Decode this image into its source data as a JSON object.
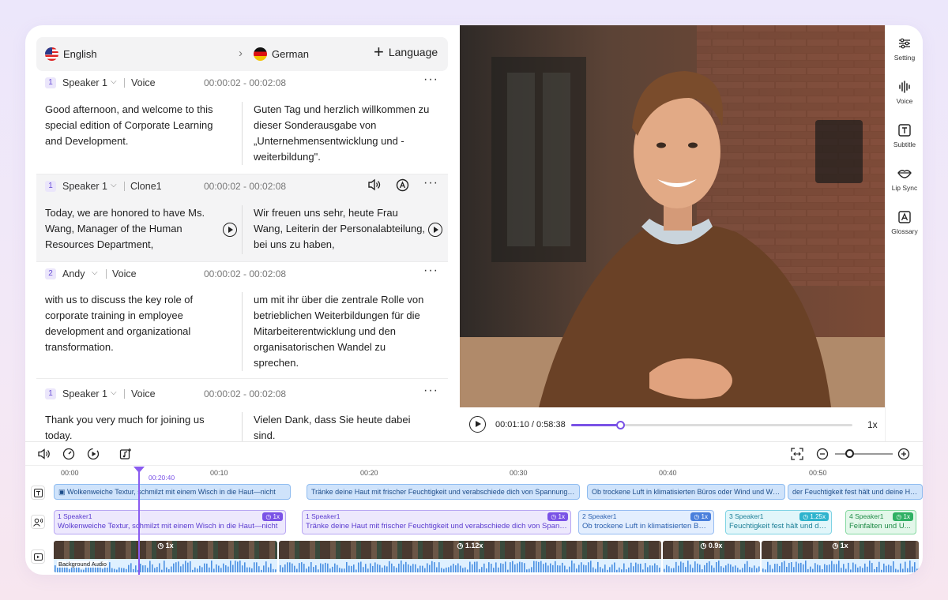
{
  "languages": {
    "source": "English",
    "target": "German",
    "add_label": "Language"
  },
  "segments": [
    {
      "num": "1",
      "speaker": "Speaker 1",
      "voice": "Voice",
      "time": "00:00:02 - 00:02:08",
      "src": "Good afternoon, and welcome to this special edition of Corporate Learning and Development.",
      "tgt": "Guten Tag und herzlich willkommen zu dieser Sonderausgabe von „Unternehmensentwicklung und -weiterbildung\"."
    },
    {
      "num": "1",
      "speaker": "Speaker 1",
      "voice": "Clone1",
      "time": "00:00:02 - 00:02:08",
      "src": "Today, we are honored to have Ms. Wang, Manager of the Human Resources Department,",
      "tgt": "Wir freuen uns sehr, heute Frau Wang, Leiterin der Personalabteilung, bei uns zu haben,"
    },
    {
      "num": "2",
      "speaker": "Andy",
      "voice": "Voice",
      "time": "00:00:02 - 00:02:08",
      "src": "with us to discuss the key role of corporate training in employee development and organizational transformation.",
      "tgt": "um mit ihr über die zentrale Rolle von betrieblichen Weiterbildungen für die Mitarbeiterentwicklung und den organisatorischen Wandel zu sprechen."
    },
    {
      "num": "1",
      "speaker": "Speaker 1",
      "voice": "Voice",
      "time": "00:00:02 - 00:02:08",
      "src": "Thank you very much for joining us today.",
      "tgt": "Vielen Dank, dass Sie heute dabei sind."
    }
  ],
  "player": {
    "current": "00:01:10",
    "total": "0:58:38",
    "separator": "/",
    "progress": 0.175,
    "speed": "1x"
  },
  "rail": [
    {
      "label": "Setting",
      "icon": "sliders-icon"
    },
    {
      "label": "Voice",
      "icon": "waveform-icon"
    },
    {
      "label": "Subtitle",
      "icon": "text-box-icon"
    },
    {
      "label": "Lip Sync",
      "icon": "lips-icon"
    },
    {
      "label": "Glossary",
      "icon": "glossary-icon"
    }
  ],
  "timeline": {
    "ticks": [
      "00:00",
      "00:10",
      "00:20",
      "00:30",
      "00:40",
      "00:50"
    ],
    "playhead_time": "00:20:40",
    "subtitles": [
      "Wolkenweiche Textur, schmilzt mit einem Wisch in die Haut—nicht",
      "Tränke deine Haut mit frischer Feuchtigkeit und verabschiede dich von Spannungsgefühl",
      "Ob trockene Luft in klimatisierten Büros oder Wind und Wetter",
      "der Feuchtigkeit fest hält und deine Haut"
    ],
    "voice_clips": [
      {
        "num": "1",
        "speaker": "Speaker1",
        "speed": "1x",
        "text": "Wolkenweiche Textur, schmilzt mit einem Wisch in die Haut—nicht"
      },
      {
        "num": "1",
        "speaker": "Speaker1",
        "speed": "1x",
        "text": "Tränke deine Haut mit frischer Feuchtigkeit und verabschiede dich von Spannungsgefühl"
      },
      {
        "num": "2",
        "speaker": "Speaker1",
        "speed": "1x",
        "text": "Ob trockene Luft in klimatisierten Büros"
      },
      {
        "num": "3",
        "speaker": "Speaker1",
        "speed": "1.25x",
        "text": "Feuchtigkeit fest hält und deine"
      },
      {
        "num": "4",
        "speaker": "Speaker1",
        "speed": "1x",
        "text": "Feinfalten und U..."
      }
    ],
    "video_clips": [
      {
        "speed": "1x"
      },
      {
        "speed": "1.12x"
      },
      {
        "speed": "0.9x"
      },
      {
        "speed": "1x"
      }
    ],
    "background_label": "Background",
    "audio_label": "Audio"
  },
  "colors": {
    "accent": "#7a52e6"
  }
}
